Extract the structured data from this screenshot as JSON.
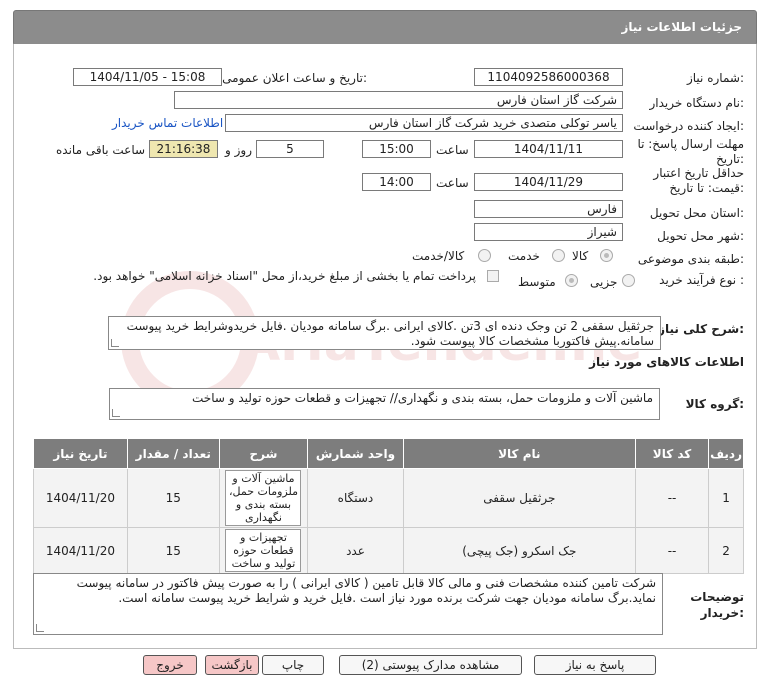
{
  "header": {
    "title": "جزئیات اطلاعات نیاز"
  },
  "form": {
    "need_number": {
      "label": "شماره نیاز:",
      "value": "1104092586000368"
    },
    "announce_datetime": {
      "label": "تاریخ و ساعت اعلان عمومی:",
      "value": "1404/11/05 - 15:08"
    },
    "buyer_org": {
      "label": "نام دستگاه خریدار:",
      "value": "شرکت گاز استان فارس"
    },
    "creator": {
      "label": "ایجاد کننده درخواست:",
      "value": "یاسر توکلی متصدی خرید شرکت گاز استان فارس",
      "contact_link": "اطلاعات تماس خریدار"
    },
    "deadline": {
      "label": "مهلت ارسال پاسخ: تا تاریخ:",
      "date": "1404/11/11",
      "time_label": "ساعت",
      "time": "15:00",
      "days": "5",
      "days_label": "روز و",
      "remaining": "21:16:38",
      "remaining_label": "ساعت باقی مانده"
    },
    "price_validity": {
      "label": "حداقل تاریخ اعتبار قیمت: تا تاریخ:",
      "date": "1404/11/29",
      "time_label": "ساعت",
      "time": "14:00"
    },
    "province": {
      "label": "استان محل تحویل:",
      "value": "فارس"
    },
    "city": {
      "label": "شهر محل تحویل:",
      "value": "شیراز"
    },
    "category": {
      "label": "طبقه بندی موضوعی:",
      "options": [
        "کالا",
        "خدمت",
        "کالا/خدمت"
      ],
      "selected": "کالا"
    },
    "process": {
      "label": "نوع فرآیند خرید :",
      "options": [
        "جزیی",
        "متوسط"
      ],
      "selected": "متوسط",
      "note": "پرداخت تمام یا بخشی از مبلغ خرید،از محل \"اسناد خزانه اسلامی\" خواهد بود."
    }
  },
  "description": {
    "label": "شرح کلی نیاز:",
    "text": "جرثقیل سقفی 2 تن وجک دنده ای 3تن .کالای ایرانی .برگ سامانه مودیان .فایل خریدوشرایط خرید پیوست سامانه.پیش فاکتوربا مشخصات کالا پیوست شود."
  },
  "goods_info": {
    "title": "اطلاعات کالاهای مورد نیاز",
    "group_label": "گروه کالا:",
    "group_value": "ماشین آلات و ملزومات حمل، بسته بندی و نگهداری// تجهیزات و قطعات حوزه تولید و ساخت"
  },
  "table": {
    "headers": [
      "ردیف",
      "کد کالا",
      "نام کالا",
      "واحد شمارش",
      "شرح",
      "تعداد / مقدار",
      "تاریخ نیاز"
    ],
    "rows": [
      {
        "index": "1",
        "code": "--",
        "name": "جرثقیل سقفی",
        "unit": "دستگاه",
        "desc": "ماشین آلات و ملزومات حمل، بسته بندی و نگهداری",
        "qty": "15",
        "date": "1404/11/20"
      },
      {
        "index": "2",
        "code": "--",
        "name": "جک اسکرو (جک پیچی)",
        "unit": "عدد",
        "desc": "تجهیزات و قطعات حوزه تولید و ساخت",
        "qty": "15",
        "date": "1404/11/20"
      }
    ]
  },
  "buyer_notes": {
    "label": "توضیحات خریدار:",
    "text": "شرکت تامین کننده مشخصات فنی و مالی کالا قابل تامین ( کالای ایرانی ) را به صورت پیش فاکتور در سامانه پیوست نماید.برگ سامانه مودیان جهت شرکت برنده مورد نیاز است .فایل خرید و شرایط خرید پیوست سامانه است."
  },
  "buttons": {
    "reply": "پاسخ به نیاز",
    "docs": "مشاهده مدارک پیوستی (2)",
    "print": "چاپ",
    "back": "بازگشت",
    "exit": "خروج"
  },
  "watermark": {
    "text": "AriaTender.net"
  }
}
